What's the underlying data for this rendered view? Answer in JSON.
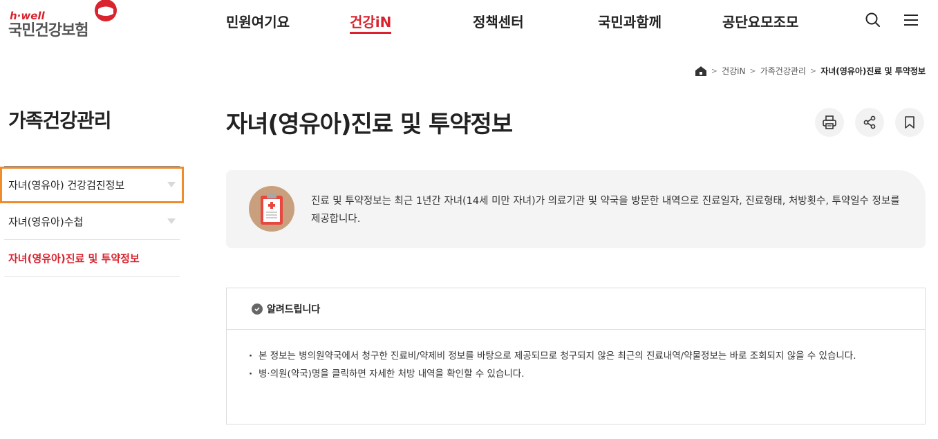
{
  "header": {
    "logo_tag": "h·well",
    "logo_name": "국민건강보험",
    "nav": [
      {
        "label": "민원여기요"
      },
      {
        "label": "건강iN"
      },
      {
        "label": "정책센터"
      },
      {
        "label": "국민과함께"
      },
      {
        "label": "공단요모조모"
      }
    ],
    "active_nav_index": 1,
    "icons": [
      "search-icon",
      "menu-icon"
    ]
  },
  "breadcrumb": {
    "items": [
      "건강iN",
      "가족건강관리",
      "자녀(영유아)진료 및 투약정보"
    ]
  },
  "sidebar": {
    "title": "가족건강관리",
    "items": [
      {
        "label": "자녀(영유아) 건강검진정보",
        "has_submenu": true
      },
      {
        "label": "자녀(영유아)수첩",
        "has_submenu": true
      },
      {
        "label": "자녀(영유아)진료 및 투약정보",
        "has_submenu": false
      }
    ]
  },
  "main": {
    "title": "자녀(영유아)진료 및 투약정보",
    "tools": [
      "print-icon",
      "share-icon",
      "bookmark-icon"
    ],
    "info_text": "진료 및 투약정보는 최근 1년간 자녀(14세 미만 자녀)가 의료기관 및 약국을 방문한 내역으로 진료일자, 진료형태, 처방횟수, 투약일수 정보를 제공합니다.",
    "notice": {
      "title": "알려드립니다",
      "items": [
        "본 정보는 병의원약국에서 청구한 진료비/약제비 정보를 바탕으로 제공되므로 청구되지 않은 최근의 진료내역/약물정보는 바로 조회되지 않을 수 있습니다.",
        "병·의원(약국)명을 클릭하면 자세한 처방 내역을 확인할 수 있습니다."
      ]
    }
  },
  "colors": {
    "brand": "#d9232e",
    "highlight": "#f08c2c"
  }
}
